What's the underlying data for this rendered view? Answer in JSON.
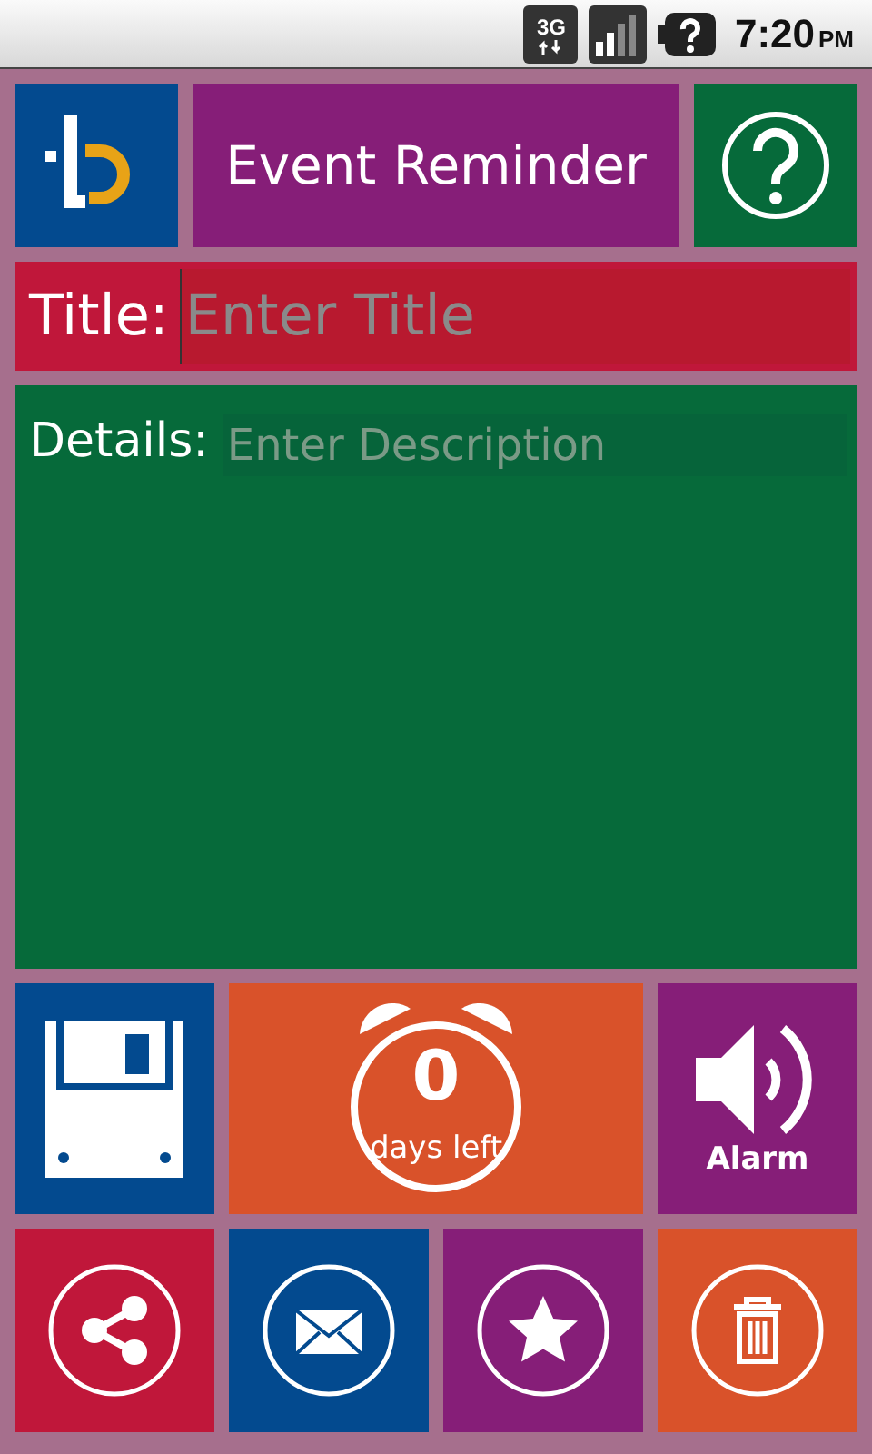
{
  "status_bar": {
    "network": "3G",
    "time": "7:20",
    "ampm": "PM"
  },
  "header": {
    "title": "Event Reminder"
  },
  "title_field": {
    "label": "Title:",
    "placeholder": "Enter Title"
  },
  "details_field": {
    "label": "Details:",
    "placeholder": "Enter Description"
  },
  "countdown": {
    "count": "0",
    "caption": "days left"
  },
  "alarm": {
    "label": "Alarm"
  },
  "actions": [
    {
      "kind": "share"
    },
    {
      "kind": "mail"
    },
    {
      "kind": "star"
    },
    {
      "kind": "delete"
    }
  ]
}
